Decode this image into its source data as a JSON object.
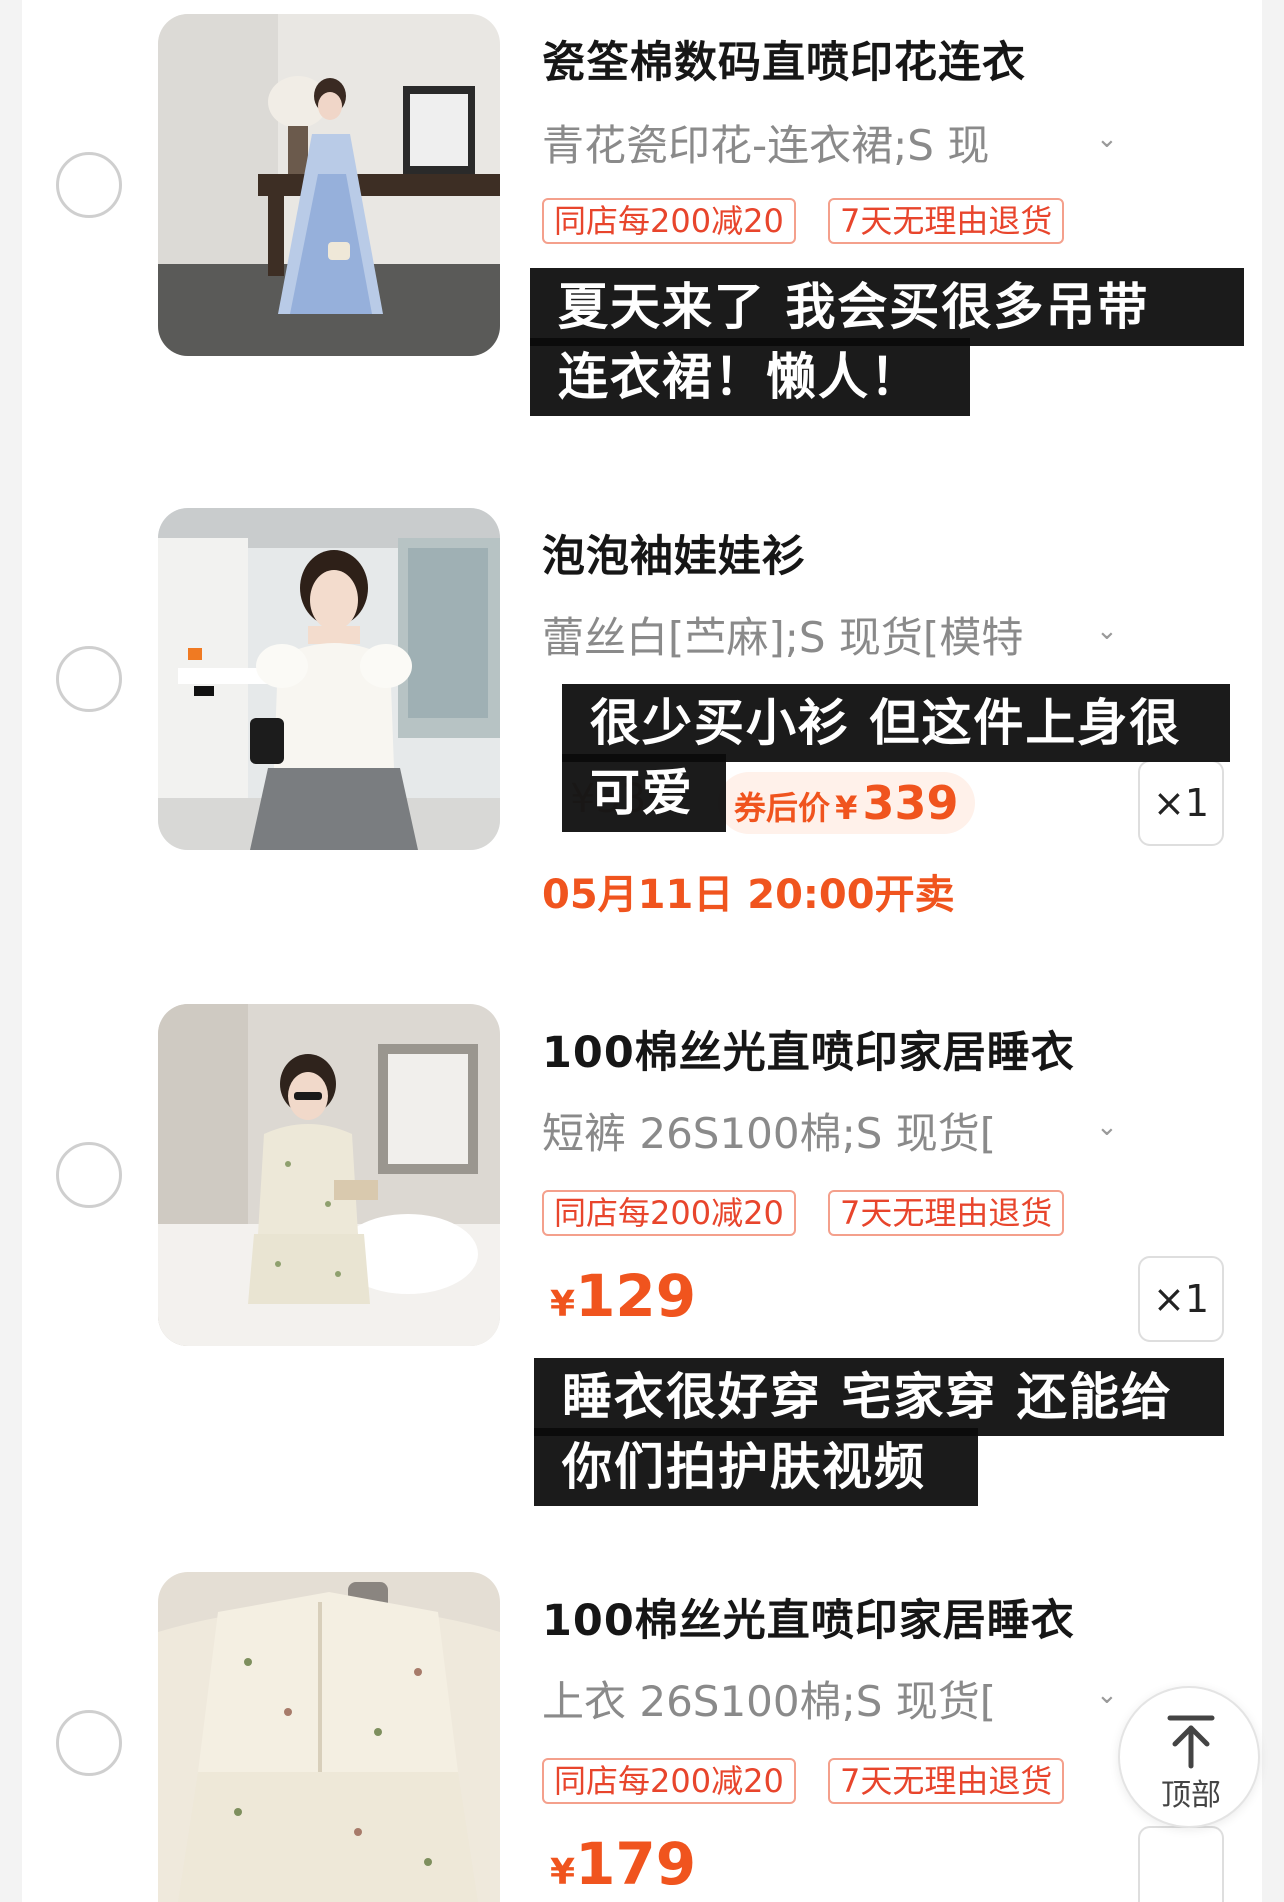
{
  "items": [
    {
      "title": "瓷筌棉数码直喷印花连衣",
      "sku": "青花瓷印花-连衣裙;S 现",
      "tags": [
        "同店每200减20",
        "7天无理由退货"
      ],
      "caption_lines": [
        "夏天来了 我会买很多吊带",
        "连衣裙！懒人！"
      ]
    },
    {
      "title": "泡泡袖娃娃衫",
      "sku": "蕾丝白[苎麻];S 现货[模特",
      "coupon_label": "券后价",
      "coupon_yen": "¥",
      "coupon_value": "339",
      "qty": "×1",
      "sale_time": "05月11日 20:00开卖",
      "caption_lines": [
        "很少买小衫 但这件上身很",
        "可爱"
      ]
    },
    {
      "title": "100棉丝光直喷印家居睡衣",
      "sku": "短裤 26S100棉;S 现货[",
      "tags": [
        "同店每200减20",
        "7天无理由退货"
      ],
      "price_yen": "¥",
      "price": "129",
      "qty": "×1",
      "caption_lines": [
        "睡衣很好穿 宅家穿 还能给",
        "你们拍护肤视频"
      ]
    },
    {
      "title": "100棉丝光直喷印家居睡衣",
      "sku": "上衣 26S100棉;S 现货[",
      "tags": [
        "同店每200减20",
        "7天无理由退货"
      ],
      "price_yen": "¥",
      "price": "179"
    }
  ],
  "back_to_top": "顶部",
  "icons": {
    "chevron": "chevron-down-icon",
    "back_to_top": "arrow-up-to-line-icon"
  },
  "colors": {
    "price_accent": "#f0541e",
    "tag_border": "#f4a08c",
    "caption_bg": "#0a0a0a"
  }
}
